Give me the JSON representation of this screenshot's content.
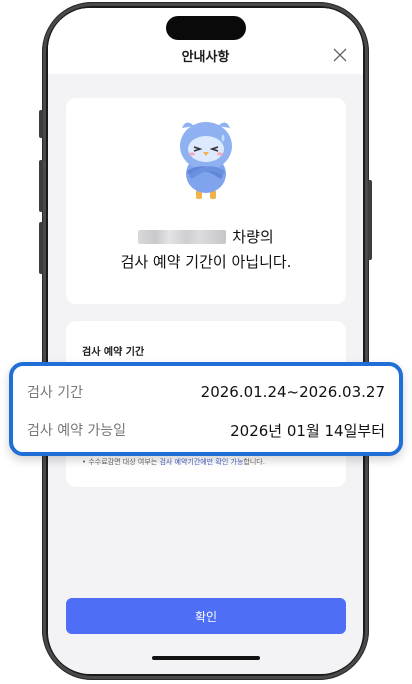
{
  "header": {
    "title": "안내사항",
    "close_icon": "close-icon"
  },
  "message": {
    "plate_blurred": true,
    "line1_suffix": "차량의",
    "line2": "검사 예약 기간이 아닙니다."
  },
  "period_card": {
    "title": "검사 예약 기간",
    "note_prefix": "• 수수료감면 대상 여부는 ",
    "note_highlight": "검사 예약기간에만 확인 가능",
    "note_suffix": "합니다."
  },
  "callout": {
    "rows": [
      {
        "label": "검사 기간",
        "value": "2026.01.24~2026.03.27"
      },
      {
        "label": "검사 예약 가능일",
        "value": "2026년 01월 14일부터"
      }
    ],
    "border_color": "#1f6fd6"
  },
  "footer": {
    "confirm_label": "확인",
    "accent": "#4d6ef5"
  }
}
